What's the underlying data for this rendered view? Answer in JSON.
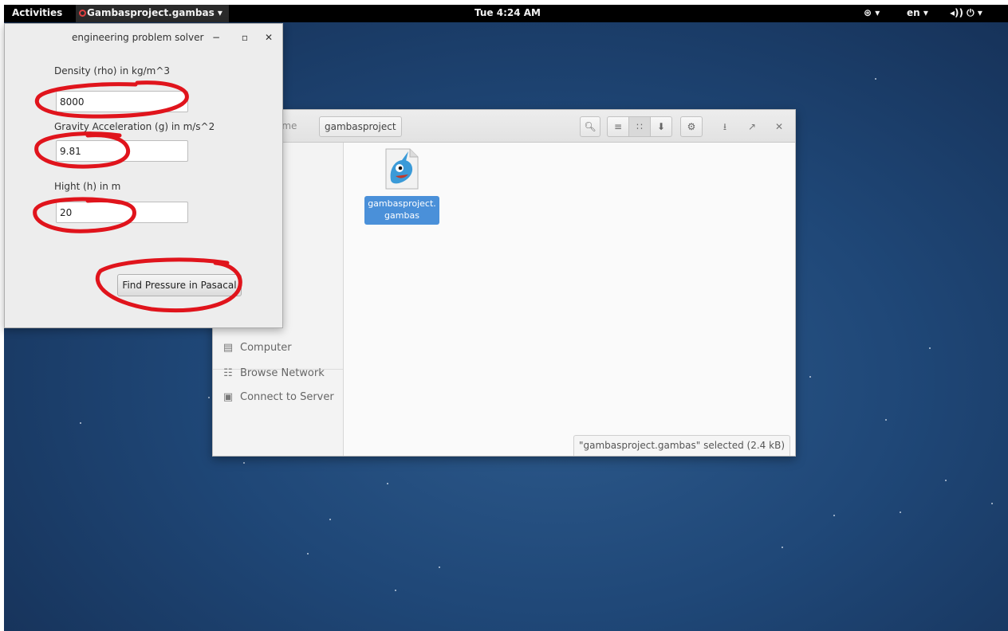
{
  "topbar": {
    "activities": "Activities",
    "app_name": "Gambasproject.gambas",
    "app_menu_arrow": "▾",
    "clock": "Tue  4:24 AM",
    "accessibility": "⊛ ▾",
    "language": "en ▾",
    "volume_power": "◂)) ⏻ ▾"
  },
  "file_manager": {
    "breadcrumb_home": "Home",
    "breadcrumb_current": "gambasproject",
    "sidebar_fragments": [
      "ts",
      "ds"
    ],
    "sidebar": [
      {
        "icon": "computer-icon",
        "label": "Computer"
      },
      {
        "icon": "network-icon",
        "label": "Browse Network"
      },
      {
        "icon": "server-icon",
        "label": "Connect to Server"
      }
    ],
    "file": {
      "name_line1": "gambasproject.",
      "name_line2": "gambas"
    },
    "status": "\"gambasproject.gambas\" selected  (2.4 kB)"
  },
  "dialog": {
    "title": "engineering problem solver",
    "fields": [
      {
        "label": "Density (rho) in kg/m^3",
        "value": "8000"
      },
      {
        "label": "Gravity Acceleration (g) in m/s^2",
        "value": "9.81"
      },
      {
        "label": "Hight (h) in m",
        "value": "20"
      }
    ],
    "button": "Find Pressure in Pasacal"
  },
  "colors": {
    "desktop": "#1f4777",
    "selection": "#4a90d9",
    "annotation": "#e0141c"
  }
}
